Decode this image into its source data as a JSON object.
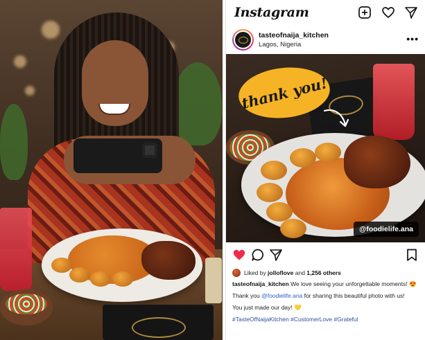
{
  "app": {
    "name": "Instagram"
  },
  "header": {
    "icons": [
      "new-post-icon",
      "heart-icon",
      "direct-message-icon"
    ]
  },
  "post": {
    "username": "tasteofnaija_kitchen",
    "location": "Lagos, Nigeria",
    "overlay_text": "thank you!",
    "tag": "@foodielife.ana",
    "liked_by_prefix": "Liked by",
    "liked_by_user": "jolloflove",
    "liked_by_and": "and",
    "likes_count": "1,256 others",
    "caption_user": "tasteofnaija_kitchen",
    "caption_line1": "We love seeing your unforgettable moments! 😍",
    "caption_line2_prefix": "Thank you",
    "caption_line2_mention": "@foodielife.ana",
    "caption_line2_suffix": "for sharing this beautiful photo with us!",
    "caption_line3": "You just made our day! 💛",
    "hashtags": "#TasteOfNaijaKitchen #CustomerLove #Grateful"
  },
  "colors": {
    "like_red": "#ed2d4a",
    "link_blue": "#2e5cc7",
    "bubble_yellow": "#f6b325"
  }
}
